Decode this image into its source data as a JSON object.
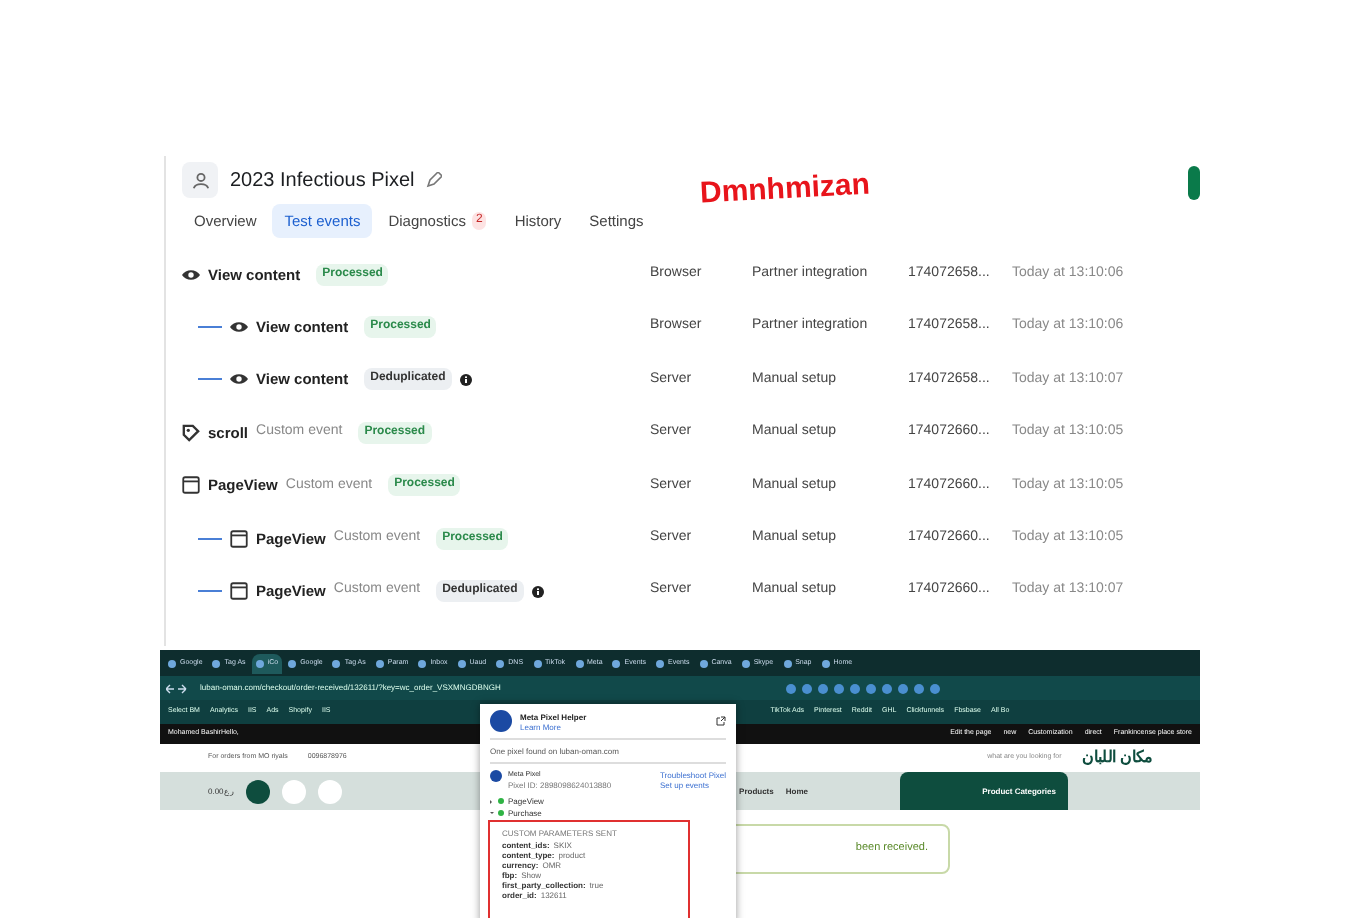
{
  "overlay_text": "Dmnhmizan",
  "pixel": {
    "title": "2023 Infectious Pixel"
  },
  "tabs": [
    {
      "label": "Overview",
      "selected": false
    },
    {
      "label": "Test events",
      "selected": true
    },
    {
      "label": "Diagnostics",
      "selected": false,
      "badge": "2"
    },
    {
      "label": "History",
      "selected": false
    },
    {
      "label": "Settings",
      "selected": false
    }
  ],
  "events": [
    {
      "kind": "eye",
      "name": "View content",
      "status": "Processed",
      "source": "Browser",
      "method": "Partner integration",
      "id": "174072658...",
      "time": "Today at 13:10:06",
      "children": [
        {
          "kind": "eye",
          "name": "View content",
          "status": "Processed",
          "source": "Browser",
          "method": "Partner integration",
          "id": "174072658...",
          "time": "Today at 13:10:06"
        },
        {
          "kind": "eye",
          "name": "View content",
          "status": "Deduplicated",
          "source": "Server",
          "method": "Manual setup",
          "id": "174072658...",
          "time": "Today at 13:10:07"
        }
      ]
    },
    {
      "kind": "scroll",
      "name": "scroll",
      "subtitle": "Custom event",
      "status": "Processed",
      "source": "Server",
      "method": "Manual setup",
      "id": "174072660...",
      "time": "Today at 13:10:05"
    },
    {
      "kind": "window",
      "name": "PageView",
      "subtitle": "Custom event",
      "status": "Processed",
      "source": "Server",
      "method": "Manual setup",
      "id": "174072660...",
      "time": "Today at 13:10:05",
      "children": [
        {
          "kind": "window",
          "name": "PageView",
          "subtitle": "Custom event",
          "status": "Processed",
          "source": "Server",
          "method": "Manual setup",
          "id": "174072660...",
          "time": "Today at 13:10:05"
        },
        {
          "kind": "window",
          "name": "PageView",
          "subtitle": "Custom event",
          "status": "Deduplicated",
          "source": "Server",
          "method": "Manual setup",
          "id": "174072660...",
          "time": "Today at 13:10:07"
        }
      ]
    }
  ],
  "browser": {
    "tabs": [
      {
        "label": "Google",
        "selected": false
      },
      {
        "label": "Tag As",
        "selected": false
      },
      {
        "label": "iCo",
        "selected": true
      },
      {
        "label": "Google",
        "selected": false
      },
      {
        "label": "Tag As",
        "selected": false
      },
      {
        "label": "Param",
        "selected": false
      },
      {
        "label": "Inbox",
        "selected": false
      },
      {
        "label": "Uaud",
        "selected": false
      },
      {
        "label": "DNS",
        "selected": false
      },
      {
        "label": "TikTok",
        "selected": false
      },
      {
        "label": "Meta",
        "selected": false
      },
      {
        "label": "Events",
        "selected": false
      },
      {
        "label": "Events",
        "selected": false
      },
      {
        "label": "Canva",
        "selected": false
      },
      {
        "label": "Skype",
        "selected": false
      },
      {
        "label": "Snap",
        "selected": false
      },
      {
        "label": "Home",
        "selected": false
      }
    ],
    "url": "luban-oman.com/checkout/order-received/132611/?key=wc_order_VSXMNGDBNGH",
    "bookmarks_left": [
      "Select BM",
      "Analytics",
      "IIS",
      "Ads",
      "Shopify",
      "IIS"
    ],
    "bookmarks_right": [
      "TikTok Ads",
      "Pinterest",
      "Reddit",
      "GHL",
      "Clickfunnels",
      "Fbsbase",
      "All Bo"
    ],
    "admin_bar": {
      "user": "Mohamed BashirHello,",
      "items": [
        "Edit the page",
        "new",
        "Customization",
        "direct",
        "Frankincense place store"
      ]
    },
    "site": {
      "notice": "For orders from MO riyals",
      "phone": "0096878976",
      "cart_total": "0.00ر.ع",
      "search_placeholder": "what are you looking for",
      "logo": "مكان اللبان",
      "nav": [
        "Products",
        "Home"
      ],
      "categories": "Product Categories",
      "message": "been received."
    },
    "pixel_helper": {
      "title": "Meta Pixel Helper",
      "link": "Learn More",
      "found": "One pixel found on luban-oman.com",
      "pixel_name": "Meta Pixel",
      "pixel_id": "Pixel ID: 2898098624013880",
      "actions": [
        "Troubleshoot Pixel",
        "Set up events"
      ],
      "events": [
        {
          "name": "PageView",
          "expanded": false
        },
        {
          "name": "Purchase",
          "expanded": true
        }
      ],
      "params_title": "CUSTOM PARAMETERS SENT",
      "params": [
        {
          "key": "content_ids:",
          "value": "SKIX"
        },
        {
          "key": "content_type:",
          "value": "product"
        },
        {
          "key": "currency:",
          "value": "OMR"
        },
        {
          "key": "fbp:",
          "value": "Show"
        },
        {
          "key": "first_party_collection:",
          "value": "true"
        },
        {
          "key": "order_id:",
          "value": "132611"
        }
      ]
    }
  }
}
